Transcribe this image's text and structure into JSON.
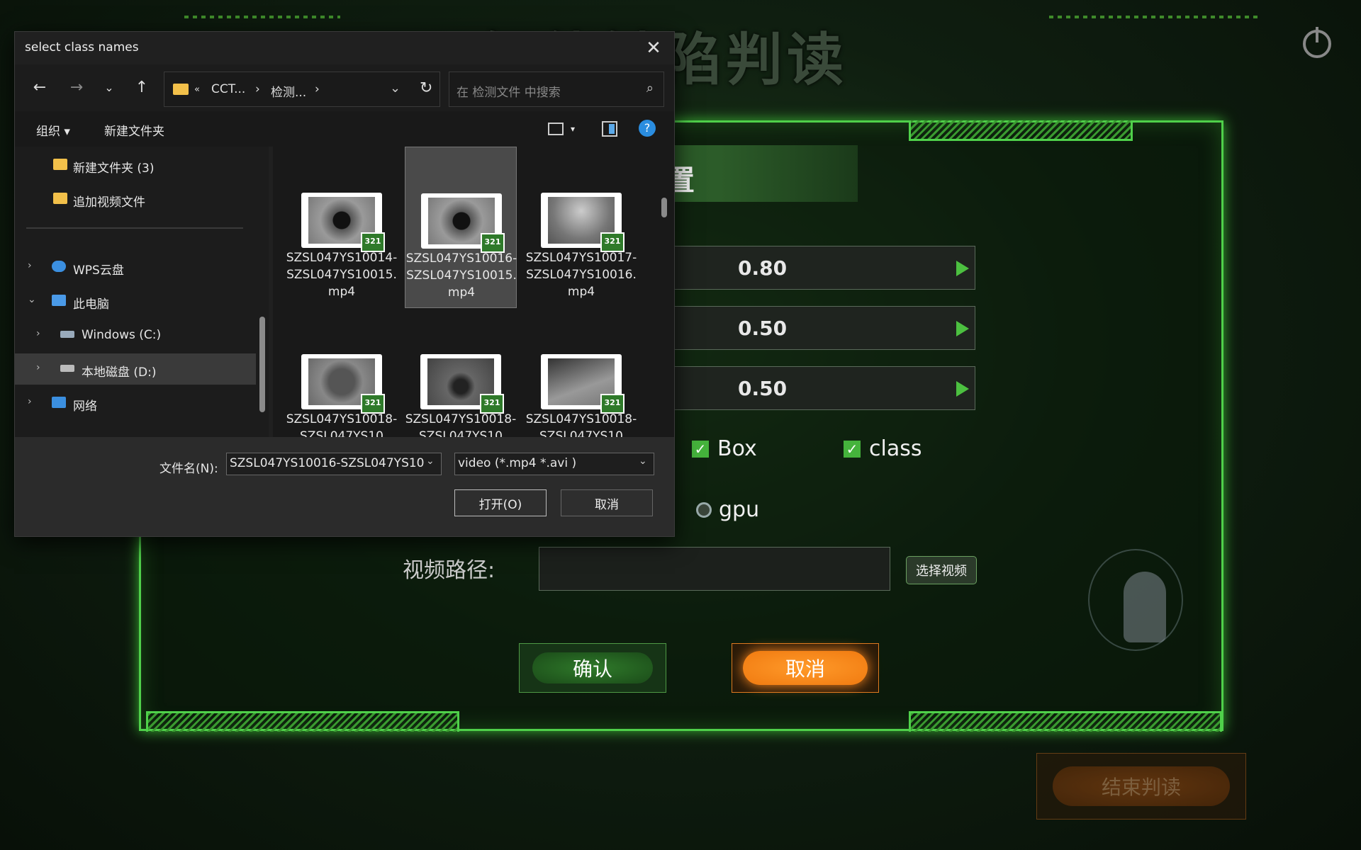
{
  "app": {
    "title": "智能缺陷判读",
    "panel_heading": "配置",
    "params": [
      "0.80",
      "0.50",
      "0.50"
    ],
    "checks": [
      {
        "label": "Box",
        "checked": true
      },
      {
        "label": "class",
        "checked": true
      }
    ],
    "radio": {
      "label": "gpu"
    },
    "video_path_label": "视频路径:",
    "video_path_value": "",
    "choose_video": "选择视频",
    "confirm": "确认",
    "cancel": "取消",
    "end": "结束判读"
  },
  "dialog": {
    "title": "select class names",
    "address": [
      "CCT...",
      "检测..."
    ],
    "search_placeholder": "在 检测文件 中搜索",
    "toolbar": {
      "organize": "组织 ▾",
      "new_folder": "新建文件夹"
    },
    "nav": [
      {
        "label": "新建文件夹 (3)",
        "icon": "folder-icon",
        "chevron": false,
        "indent": 1
      },
      {
        "label": "追加视频文件",
        "icon": "folder-icon",
        "chevron": false,
        "indent": 1
      },
      {
        "label": "WPS云盘",
        "icon": "cloud-icon",
        "chevron": "›",
        "indent": 0
      },
      {
        "label": "此电脑",
        "icon": "pc-icon",
        "chevron": "⌄",
        "indent": 0
      },
      {
        "label": "Windows (C:)",
        "icon": "drive-icon",
        "chevron": "›",
        "indent": 2
      },
      {
        "label": "本地磁盘 (D:)",
        "icon": "drive-icon",
        "chevron": "›",
        "indent": 2,
        "selected": true
      },
      {
        "label": "网络",
        "icon": "network-icon",
        "chevron": "›",
        "indent": 0
      }
    ],
    "files": [
      {
        "name": "SZSL047YS10014-SZSL047YS10015.mp4",
        "selected": false
      },
      {
        "name": "SZSL047YS10016-SZSL047YS10015.mp4",
        "selected": true
      },
      {
        "name": "SZSL047YS10017-SZSL047YS10016.mp4",
        "selected": false
      },
      {
        "name": "SZSL047YS10018-SZSL047YS10",
        "selected": false
      },
      {
        "name": "SZSL047YS10018-SZSL047YS10",
        "selected": false
      },
      {
        "name": "SZSL047YS10018-SZSL047YS10",
        "selected": false
      }
    ],
    "thumb_badge": "321",
    "filename_label": "文件名(N):",
    "filename_value": "SZSL047YS10016-SZSL047YS10",
    "filter": "video (*.mp4 *.avi )",
    "open": "打开(O)",
    "cancel": "取消"
  }
}
